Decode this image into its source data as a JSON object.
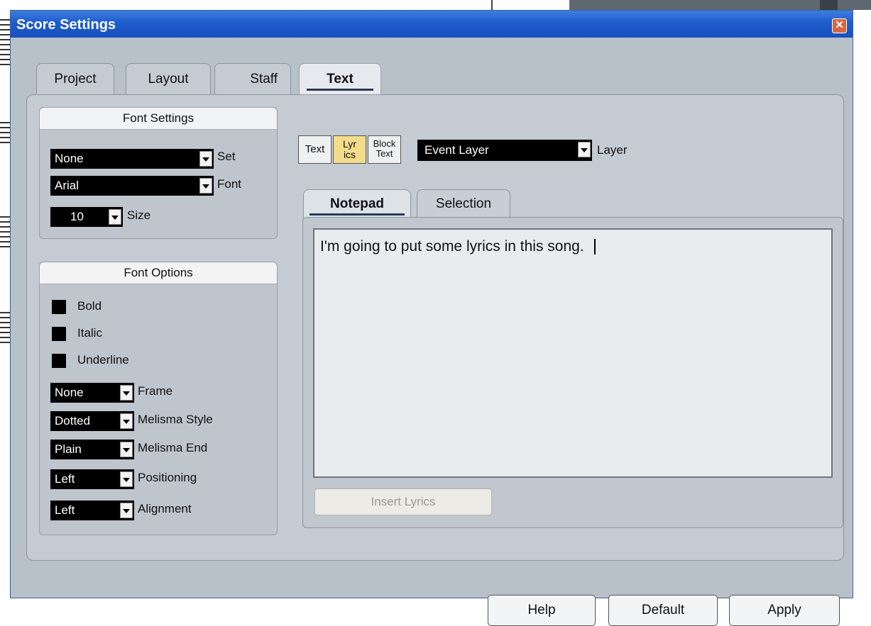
{
  "window": {
    "title": "Score Settings",
    "close_icon": "close-icon"
  },
  "tabs": [
    {
      "label": "Project",
      "active": false
    },
    {
      "label": "Layout",
      "active": false
    },
    {
      "label": "Staff",
      "active": false
    },
    {
      "label": "Text",
      "active": true
    }
  ],
  "font_settings": {
    "header": "Font Settings",
    "set_value": "None",
    "set_label": "Set",
    "font_value": "Arial",
    "font_label": "Font",
    "size_value": "10",
    "size_label": "Size"
  },
  "font_options": {
    "header": "Font Options",
    "bold_label": "Bold",
    "italic_label": "Italic",
    "underline_label": "Underline",
    "frame_value": "None",
    "frame_label": "Frame",
    "melisma_style_value": "Dotted",
    "melisma_style_label": "Melisma Style",
    "melisma_end_value": "Plain",
    "melisma_end_label": "Melisma End",
    "positioning_value": "Left",
    "positioning_label": "Positioning",
    "alignment_value": "Left",
    "alignment_label": "Alignment"
  },
  "mode_buttons": {
    "text": "Text",
    "lyrics_line1": "Lyr",
    "lyrics_line2": "ics",
    "block_line1": "Block",
    "block_line2": "Text",
    "active": "lyrics"
  },
  "layer": {
    "value": "Event Layer",
    "label": "Layer"
  },
  "inner_tabs": [
    {
      "label": "Notepad",
      "active": true
    },
    {
      "label": "Selection",
      "active": false
    }
  ],
  "notepad": {
    "text": "I'm going to put some lyrics in this song."
  },
  "insert_button": "Insert Lyrics",
  "footer": {
    "help": "Help",
    "default": "Default",
    "apply": "Apply"
  },
  "colors": {
    "titlebar": "#1e5ccc",
    "active_mode": "#f4dc8a"
  }
}
